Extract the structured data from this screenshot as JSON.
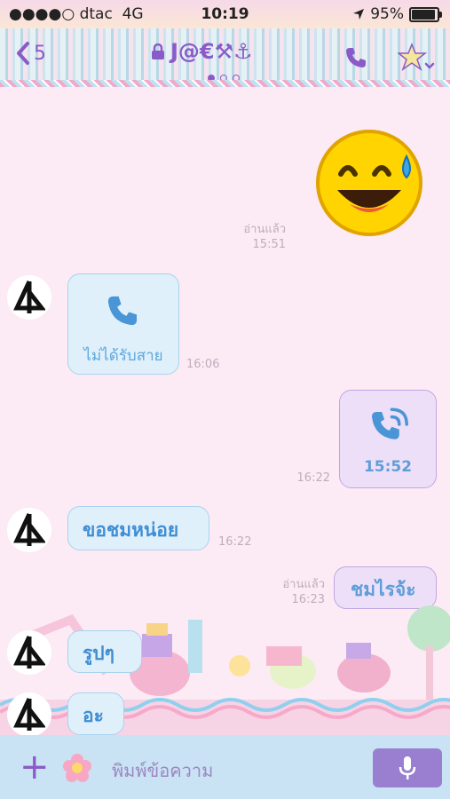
{
  "status_bar": {
    "carrier": "●●●●○ dtac",
    "network": "4G",
    "time": "10:19",
    "battery": "95%"
  },
  "header": {
    "back_count": "5",
    "chat_title": "J@€⚒⚓",
    "accent_color": "#8a5bc8"
  },
  "messages": [
    {
      "side": "right",
      "type": "sticker",
      "read_label": "อ่านแล้ว",
      "time": "15:51"
    },
    {
      "side": "left",
      "type": "missed_call",
      "text": "ไม่ได้รับสาย",
      "time": "16:06"
    },
    {
      "side": "right",
      "type": "call",
      "duration": "15:52",
      "time": "16:22"
    },
    {
      "side": "left",
      "type": "text",
      "text": "ขอชมหน่อย",
      "time": "16:22"
    },
    {
      "side": "right",
      "type": "text",
      "text": "ชมไรจ้ะ",
      "read_label": "อ่านแล้ว",
      "time": "16:23"
    },
    {
      "side": "left",
      "type": "text",
      "text": "รูปๆ"
    },
    {
      "side": "left",
      "type": "text",
      "text": "อะ"
    }
  ],
  "input_bar": {
    "placeholder": "พิมพ์ข้อความ",
    "icons": [
      "plus-icon",
      "flower-emoji-icon",
      "microphone-icon"
    ]
  }
}
